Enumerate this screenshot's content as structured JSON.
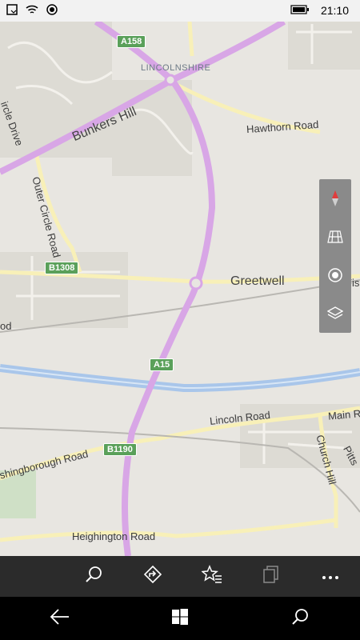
{
  "status": {
    "time": "21:10"
  },
  "map": {
    "labels": {
      "region": "LINCOLNSHIRE",
      "bunkers": "Bunkers Hill",
      "hawthorn": "Hawthorn Road",
      "circle_drive": "ircle Drive",
      "outer_circle": "Outer Circle Road",
      "greetwell": "Greetwell",
      "fis": "Fis",
      "lincoln_road": "Lincoln Road",
      "main_road": "Main R",
      "church_hill": "Church Hill",
      "pitts": "Pitts",
      "washingborough": "shingborough Road",
      "heighington": "Heighington Road",
      "od": "od"
    },
    "shields": {
      "a158": "A158",
      "b1308": "B1308",
      "a15": "A15",
      "b1190": "B1190"
    }
  },
  "controls": [
    "north-arrow-icon",
    "map-view-icon",
    "locate-me-icon",
    "layers-icon"
  ],
  "appbar": [
    "search-icon",
    "directions-icon",
    "favorites-icon",
    "collections-icon",
    "more-icon"
  ],
  "colors": {
    "map_bg": "#e8e6e1",
    "highway": "#d8a6e6",
    "river": "#a9c6ea",
    "road_yellow": "#f8f0b8",
    "shield_green": "#5aa05a"
  }
}
